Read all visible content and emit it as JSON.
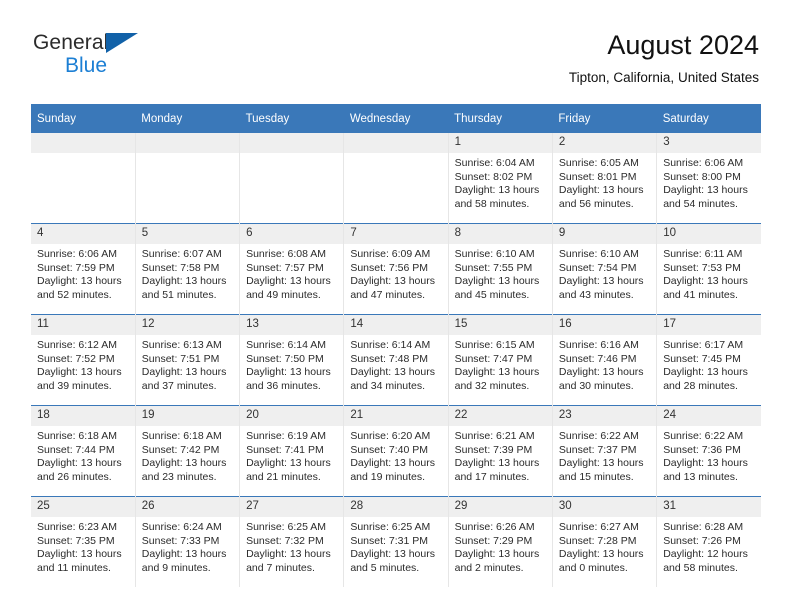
{
  "brand": {
    "name_part1": "General",
    "name_part2": "Blue",
    "accent_color": "#1c7fd4",
    "triangle_color": "#1161a8"
  },
  "header": {
    "title": "August 2024",
    "subtitle": "Tipton, California, United States"
  },
  "theme": {
    "header_row_bg": "#3a78b9",
    "date_band_bg": "#efefef",
    "grid_line": "#e6e6e6"
  },
  "weekday_headers": [
    "Sunday",
    "Monday",
    "Tuesday",
    "Wednesday",
    "Thursday",
    "Friday",
    "Saturday"
  ],
  "weeks": [
    [
      {
        "day": "",
        "lines": []
      },
      {
        "day": "",
        "lines": []
      },
      {
        "day": "",
        "lines": []
      },
      {
        "day": "",
        "lines": []
      },
      {
        "day": "1",
        "lines": [
          "Sunrise: 6:04 AM",
          "Sunset: 8:02 PM",
          "Daylight: 13 hours",
          "and 58 minutes."
        ]
      },
      {
        "day": "2",
        "lines": [
          "Sunrise: 6:05 AM",
          "Sunset: 8:01 PM",
          "Daylight: 13 hours",
          "and 56 minutes."
        ]
      },
      {
        "day": "3",
        "lines": [
          "Sunrise: 6:06 AM",
          "Sunset: 8:00 PM",
          "Daylight: 13 hours",
          "and 54 minutes."
        ]
      }
    ],
    [
      {
        "day": "4",
        "lines": [
          "Sunrise: 6:06 AM",
          "Sunset: 7:59 PM",
          "Daylight: 13 hours",
          "and 52 minutes."
        ]
      },
      {
        "day": "5",
        "lines": [
          "Sunrise: 6:07 AM",
          "Sunset: 7:58 PM",
          "Daylight: 13 hours",
          "and 51 minutes."
        ]
      },
      {
        "day": "6",
        "lines": [
          "Sunrise: 6:08 AM",
          "Sunset: 7:57 PM",
          "Daylight: 13 hours",
          "and 49 minutes."
        ]
      },
      {
        "day": "7",
        "lines": [
          "Sunrise: 6:09 AM",
          "Sunset: 7:56 PM",
          "Daylight: 13 hours",
          "and 47 minutes."
        ]
      },
      {
        "day": "8",
        "lines": [
          "Sunrise: 6:10 AM",
          "Sunset: 7:55 PM",
          "Daylight: 13 hours",
          "and 45 minutes."
        ]
      },
      {
        "day": "9",
        "lines": [
          "Sunrise: 6:10 AM",
          "Sunset: 7:54 PM",
          "Daylight: 13 hours",
          "and 43 minutes."
        ]
      },
      {
        "day": "10",
        "lines": [
          "Sunrise: 6:11 AM",
          "Sunset: 7:53 PM",
          "Daylight: 13 hours",
          "and 41 minutes."
        ]
      }
    ],
    [
      {
        "day": "11",
        "lines": [
          "Sunrise: 6:12 AM",
          "Sunset: 7:52 PM",
          "Daylight: 13 hours",
          "and 39 minutes."
        ]
      },
      {
        "day": "12",
        "lines": [
          "Sunrise: 6:13 AM",
          "Sunset: 7:51 PM",
          "Daylight: 13 hours",
          "and 37 minutes."
        ]
      },
      {
        "day": "13",
        "lines": [
          "Sunrise: 6:14 AM",
          "Sunset: 7:50 PM",
          "Daylight: 13 hours",
          "and 36 minutes."
        ]
      },
      {
        "day": "14",
        "lines": [
          "Sunrise: 6:14 AM",
          "Sunset: 7:48 PM",
          "Daylight: 13 hours",
          "and 34 minutes."
        ]
      },
      {
        "day": "15",
        "lines": [
          "Sunrise: 6:15 AM",
          "Sunset: 7:47 PM",
          "Daylight: 13 hours",
          "and 32 minutes."
        ]
      },
      {
        "day": "16",
        "lines": [
          "Sunrise: 6:16 AM",
          "Sunset: 7:46 PM",
          "Daylight: 13 hours",
          "and 30 minutes."
        ]
      },
      {
        "day": "17",
        "lines": [
          "Sunrise: 6:17 AM",
          "Sunset: 7:45 PM",
          "Daylight: 13 hours",
          "and 28 minutes."
        ]
      }
    ],
    [
      {
        "day": "18",
        "lines": [
          "Sunrise: 6:18 AM",
          "Sunset: 7:44 PM",
          "Daylight: 13 hours",
          "and 26 minutes."
        ]
      },
      {
        "day": "19",
        "lines": [
          "Sunrise: 6:18 AM",
          "Sunset: 7:42 PM",
          "Daylight: 13 hours",
          "and 23 minutes."
        ]
      },
      {
        "day": "20",
        "lines": [
          "Sunrise: 6:19 AM",
          "Sunset: 7:41 PM",
          "Daylight: 13 hours",
          "and 21 minutes."
        ]
      },
      {
        "day": "21",
        "lines": [
          "Sunrise: 6:20 AM",
          "Sunset: 7:40 PM",
          "Daylight: 13 hours",
          "and 19 minutes."
        ]
      },
      {
        "day": "22",
        "lines": [
          "Sunrise: 6:21 AM",
          "Sunset: 7:39 PM",
          "Daylight: 13 hours",
          "and 17 minutes."
        ]
      },
      {
        "day": "23",
        "lines": [
          "Sunrise: 6:22 AM",
          "Sunset: 7:37 PM",
          "Daylight: 13 hours",
          "and 15 minutes."
        ]
      },
      {
        "day": "24",
        "lines": [
          "Sunrise: 6:22 AM",
          "Sunset: 7:36 PM",
          "Daylight: 13 hours",
          "and 13 minutes."
        ]
      }
    ],
    [
      {
        "day": "25",
        "lines": [
          "Sunrise: 6:23 AM",
          "Sunset: 7:35 PM",
          "Daylight: 13 hours",
          "and 11 minutes."
        ]
      },
      {
        "day": "26",
        "lines": [
          "Sunrise: 6:24 AM",
          "Sunset: 7:33 PM",
          "Daylight: 13 hours",
          "and 9 minutes."
        ]
      },
      {
        "day": "27",
        "lines": [
          "Sunrise: 6:25 AM",
          "Sunset: 7:32 PM",
          "Daylight: 13 hours",
          "and 7 minutes."
        ]
      },
      {
        "day": "28",
        "lines": [
          "Sunrise: 6:25 AM",
          "Sunset: 7:31 PM",
          "Daylight: 13 hours",
          "and 5 minutes."
        ]
      },
      {
        "day": "29",
        "lines": [
          "Sunrise: 6:26 AM",
          "Sunset: 7:29 PM",
          "Daylight: 13 hours",
          "and 2 minutes."
        ]
      },
      {
        "day": "30",
        "lines": [
          "Sunrise: 6:27 AM",
          "Sunset: 7:28 PM",
          "Daylight: 13 hours",
          "and 0 minutes."
        ]
      },
      {
        "day": "31",
        "lines": [
          "Sunrise: 6:28 AM",
          "Sunset: 7:26 PM",
          "Daylight: 12 hours",
          "and 58 minutes."
        ]
      }
    ]
  ]
}
